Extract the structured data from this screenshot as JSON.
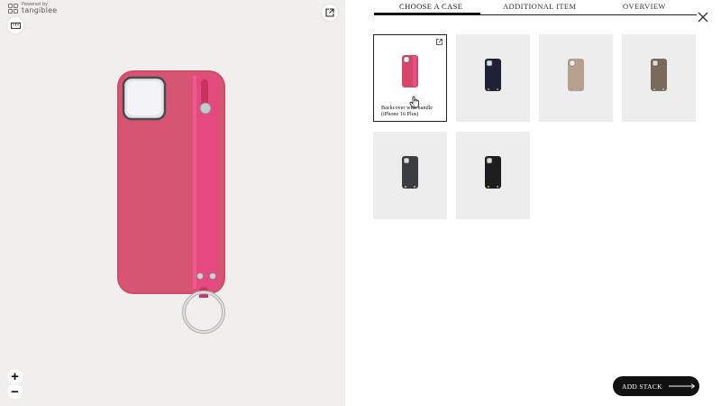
{
  "brand": {
    "powered": "Powered by",
    "name": "tangiblee"
  },
  "tabs": [
    {
      "label": "CHOOSE A CASE",
      "active": true
    },
    {
      "label": "ADDITIONAL ITEM",
      "active": false
    },
    {
      "label": "OVERVIEW",
      "active": false
    }
  ],
  "zoom": {
    "in": "+",
    "out": "−"
  },
  "products": [
    {
      "label_line1": "Backcover with handle",
      "label_line2": "(iPhone 16 Plus)",
      "color": "#d6466a",
      "selected": true
    },
    {
      "label_line1": "",
      "label_line2": "",
      "color": "#1f2236",
      "selected": false
    },
    {
      "label_line1": "",
      "label_line2": "",
      "color": "#b7a08e",
      "selected": false
    },
    {
      "label_line1": "",
      "label_line2": "",
      "color": "#7a6a5c",
      "selected": false
    },
    {
      "label_line1": "",
      "label_line2": "",
      "color": "#3b3d42",
      "selected": false
    },
    {
      "label_line1": "",
      "label_line2": "",
      "color": "#1e1e1f",
      "selected": false
    }
  ],
  "cta": {
    "label": "ADD STACK"
  },
  "colors": {
    "case_main": "#d14b68",
    "strap": "#e0457a",
    "viewer_bg": "#f1efed"
  },
  "icons": [
    "ruler-icon",
    "share-icon",
    "close-icon",
    "external-link-icon",
    "arrow-right-icon",
    "hand-cursor-icon"
  ]
}
